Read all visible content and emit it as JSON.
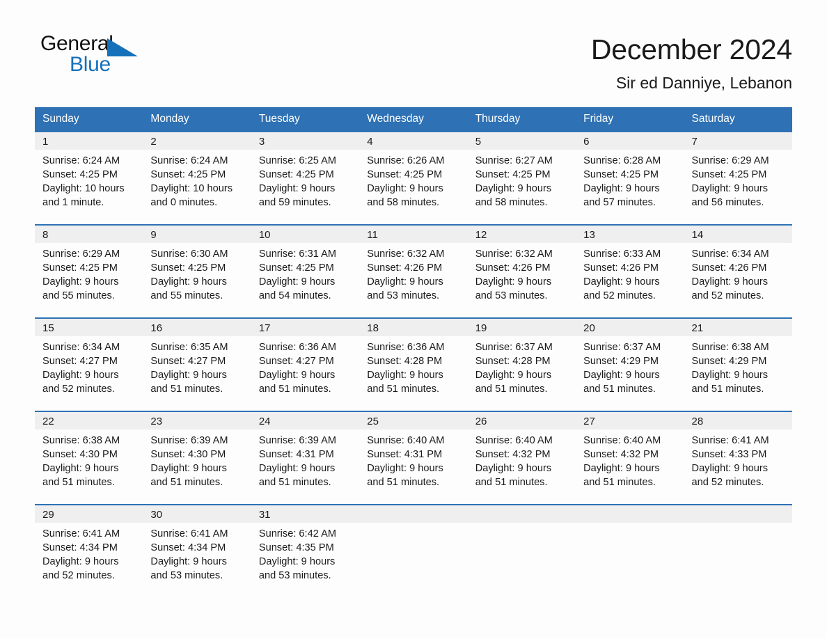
{
  "brand": {
    "name_part1": "General",
    "name_part2": "Blue",
    "accent_color": "#1572ba"
  },
  "header": {
    "month_title": "December 2024",
    "location": "Sir ed Danniye, Lebanon"
  },
  "theme": {
    "header_blue": "#2e71b4",
    "daynum_gray": "#efefef",
    "text": "#1a1a1a"
  },
  "weekdays": [
    "Sunday",
    "Monday",
    "Tuesday",
    "Wednesday",
    "Thursday",
    "Friday",
    "Saturday"
  ],
  "weeks": [
    [
      {
        "day": "1",
        "sunrise": "Sunrise: 6:24 AM",
        "sunset": "Sunset: 4:25 PM",
        "daylight1": "Daylight: 10 hours",
        "daylight2": "and 1 minute."
      },
      {
        "day": "2",
        "sunrise": "Sunrise: 6:24 AM",
        "sunset": "Sunset: 4:25 PM",
        "daylight1": "Daylight: 10 hours",
        "daylight2": "and 0 minutes."
      },
      {
        "day": "3",
        "sunrise": "Sunrise: 6:25 AM",
        "sunset": "Sunset: 4:25 PM",
        "daylight1": "Daylight: 9 hours",
        "daylight2": "and 59 minutes."
      },
      {
        "day": "4",
        "sunrise": "Sunrise: 6:26 AM",
        "sunset": "Sunset: 4:25 PM",
        "daylight1": "Daylight: 9 hours",
        "daylight2": "and 58 minutes."
      },
      {
        "day": "5",
        "sunrise": "Sunrise: 6:27 AM",
        "sunset": "Sunset: 4:25 PM",
        "daylight1": "Daylight: 9 hours",
        "daylight2": "and 58 minutes."
      },
      {
        "day": "6",
        "sunrise": "Sunrise: 6:28 AM",
        "sunset": "Sunset: 4:25 PM",
        "daylight1": "Daylight: 9 hours",
        "daylight2": "and 57 minutes."
      },
      {
        "day": "7",
        "sunrise": "Sunrise: 6:29 AM",
        "sunset": "Sunset: 4:25 PM",
        "daylight1": "Daylight: 9 hours",
        "daylight2": "and 56 minutes."
      }
    ],
    [
      {
        "day": "8",
        "sunrise": "Sunrise: 6:29 AM",
        "sunset": "Sunset: 4:25 PM",
        "daylight1": "Daylight: 9 hours",
        "daylight2": "and 55 minutes."
      },
      {
        "day": "9",
        "sunrise": "Sunrise: 6:30 AM",
        "sunset": "Sunset: 4:25 PM",
        "daylight1": "Daylight: 9 hours",
        "daylight2": "and 55 minutes."
      },
      {
        "day": "10",
        "sunrise": "Sunrise: 6:31 AM",
        "sunset": "Sunset: 4:25 PM",
        "daylight1": "Daylight: 9 hours",
        "daylight2": "and 54 minutes."
      },
      {
        "day": "11",
        "sunrise": "Sunrise: 6:32 AM",
        "sunset": "Sunset: 4:26 PM",
        "daylight1": "Daylight: 9 hours",
        "daylight2": "and 53 minutes."
      },
      {
        "day": "12",
        "sunrise": "Sunrise: 6:32 AM",
        "sunset": "Sunset: 4:26 PM",
        "daylight1": "Daylight: 9 hours",
        "daylight2": "and 53 minutes."
      },
      {
        "day": "13",
        "sunrise": "Sunrise: 6:33 AM",
        "sunset": "Sunset: 4:26 PM",
        "daylight1": "Daylight: 9 hours",
        "daylight2": "and 52 minutes."
      },
      {
        "day": "14",
        "sunrise": "Sunrise: 6:34 AM",
        "sunset": "Sunset: 4:26 PM",
        "daylight1": "Daylight: 9 hours",
        "daylight2": "and 52 minutes."
      }
    ],
    [
      {
        "day": "15",
        "sunrise": "Sunrise: 6:34 AM",
        "sunset": "Sunset: 4:27 PM",
        "daylight1": "Daylight: 9 hours",
        "daylight2": "and 52 minutes."
      },
      {
        "day": "16",
        "sunrise": "Sunrise: 6:35 AM",
        "sunset": "Sunset: 4:27 PM",
        "daylight1": "Daylight: 9 hours",
        "daylight2": "and 51 minutes."
      },
      {
        "day": "17",
        "sunrise": "Sunrise: 6:36 AM",
        "sunset": "Sunset: 4:27 PM",
        "daylight1": "Daylight: 9 hours",
        "daylight2": "and 51 minutes."
      },
      {
        "day": "18",
        "sunrise": "Sunrise: 6:36 AM",
        "sunset": "Sunset: 4:28 PM",
        "daylight1": "Daylight: 9 hours",
        "daylight2": "and 51 minutes."
      },
      {
        "day": "19",
        "sunrise": "Sunrise: 6:37 AM",
        "sunset": "Sunset: 4:28 PM",
        "daylight1": "Daylight: 9 hours",
        "daylight2": "and 51 minutes."
      },
      {
        "day": "20",
        "sunrise": "Sunrise: 6:37 AM",
        "sunset": "Sunset: 4:29 PM",
        "daylight1": "Daylight: 9 hours",
        "daylight2": "and 51 minutes."
      },
      {
        "day": "21",
        "sunrise": "Sunrise: 6:38 AM",
        "sunset": "Sunset: 4:29 PM",
        "daylight1": "Daylight: 9 hours",
        "daylight2": "and 51 minutes."
      }
    ],
    [
      {
        "day": "22",
        "sunrise": "Sunrise: 6:38 AM",
        "sunset": "Sunset: 4:30 PM",
        "daylight1": "Daylight: 9 hours",
        "daylight2": "and 51 minutes."
      },
      {
        "day": "23",
        "sunrise": "Sunrise: 6:39 AM",
        "sunset": "Sunset: 4:30 PM",
        "daylight1": "Daylight: 9 hours",
        "daylight2": "and 51 minutes."
      },
      {
        "day": "24",
        "sunrise": "Sunrise: 6:39 AM",
        "sunset": "Sunset: 4:31 PM",
        "daylight1": "Daylight: 9 hours",
        "daylight2": "and 51 minutes."
      },
      {
        "day": "25",
        "sunrise": "Sunrise: 6:40 AM",
        "sunset": "Sunset: 4:31 PM",
        "daylight1": "Daylight: 9 hours",
        "daylight2": "and 51 minutes."
      },
      {
        "day": "26",
        "sunrise": "Sunrise: 6:40 AM",
        "sunset": "Sunset: 4:32 PM",
        "daylight1": "Daylight: 9 hours",
        "daylight2": "and 51 minutes."
      },
      {
        "day": "27",
        "sunrise": "Sunrise: 6:40 AM",
        "sunset": "Sunset: 4:32 PM",
        "daylight1": "Daylight: 9 hours",
        "daylight2": "and 51 minutes."
      },
      {
        "day": "28",
        "sunrise": "Sunrise: 6:41 AM",
        "sunset": "Sunset: 4:33 PM",
        "daylight1": "Daylight: 9 hours",
        "daylight2": "and 52 minutes."
      }
    ],
    [
      {
        "day": "29",
        "sunrise": "Sunrise: 6:41 AM",
        "sunset": "Sunset: 4:34 PM",
        "daylight1": "Daylight: 9 hours",
        "daylight2": "and 52 minutes."
      },
      {
        "day": "30",
        "sunrise": "Sunrise: 6:41 AM",
        "sunset": "Sunset: 4:34 PM",
        "daylight1": "Daylight: 9 hours",
        "daylight2": "and 53 minutes."
      },
      {
        "day": "31",
        "sunrise": "Sunrise: 6:42 AM",
        "sunset": "Sunset: 4:35 PM",
        "daylight1": "Daylight: 9 hours",
        "daylight2": "and 53 minutes."
      },
      {
        "day": "",
        "sunrise": "",
        "sunset": "",
        "daylight1": "",
        "daylight2": ""
      },
      {
        "day": "",
        "sunrise": "",
        "sunset": "",
        "daylight1": "",
        "daylight2": ""
      },
      {
        "day": "",
        "sunrise": "",
        "sunset": "",
        "daylight1": "",
        "daylight2": ""
      },
      {
        "day": "",
        "sunrise": "",
        "sunset": "",
        "daylight1": "",
        "daylight2": ""
      }
    ]
  ]
}
